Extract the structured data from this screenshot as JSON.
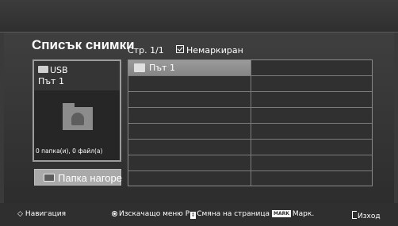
{
  "title": "Списък снимки",
  "page_info": "Стр. 1/1",
  "mark_status": "Немаркиран",
  "preview": {
    "device": "USB",
    "path": "Път 1",
    "count_info": "0 папка(и), 0 файл(а)"
  },
  "up_button_label": "Папка нагоре",
  "file_list": {
    "items": [
      {
        "label": "Път 1",
        "type": "folder",
        "selected": true
      }
    ]
  },
  "bottom_bar": {
    "navigation": "Навигация",
    "popup_menu": "Изскачащо меню",
    "p_key": "P",
    "page_change": "Смяна на страница",
    "mark_key": "MARK",
    "mark": "Марк.",
    "exit": "Изход"
  }
}
